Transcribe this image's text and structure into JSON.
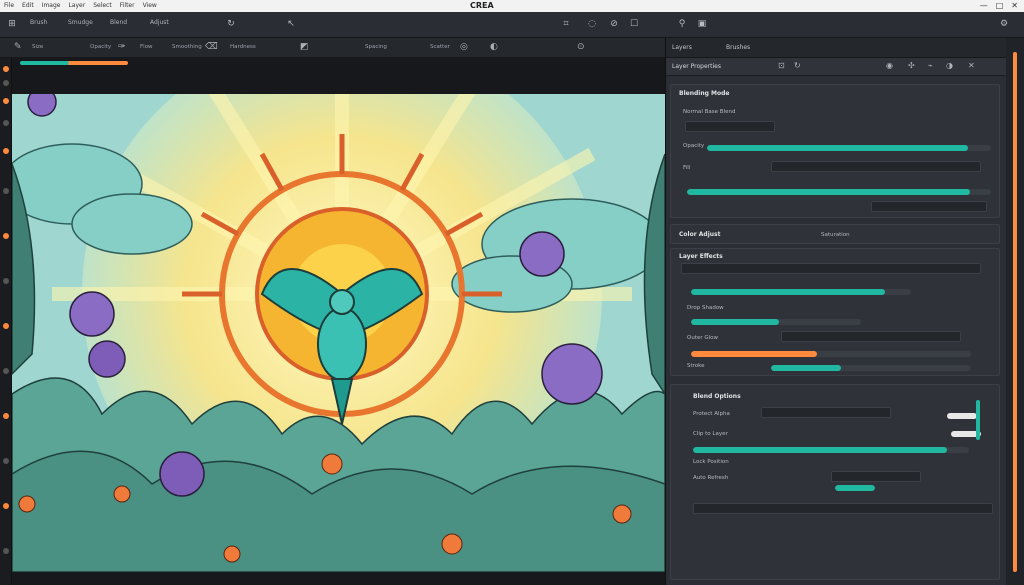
{
  "titlebar": {
    "menu": [
      "File",
      "Edit",
      "Image",
      "Layer",
      "Select",
      "Filter",
      "View"
    ],
    "title": "CREA",
    "window_buttons": [
      "—",
      "□",
      "✕"
    ]
  },
  "toolbar1": {
    "items": [
      "Brush",
      "Smudge",
      "Blend",
      "Adjust"
    ],
    "icons": [
      "rotate-icon",
      "cursor-icon",
      "crop-icon",
      "lasso-icon",
      "eyedropper-icon",
      "hand-icon",
      "zoom-icon"
    ]
  },
  "toolbar2": {
    "items": [
      "Size",
      "Opacity",
      "Flow",
      "Smoothing",
      "Hardness",
      "Spacing",
      "Scatter"
    ],
    "icons": [
      "brush-icon",
      "pen-icon",
      "eraser-icon",
      "fill-icon",
      "blur-icon",
      "gradient-icon"
    ]
  },
  "canvas": {
    "progress": 1.0,
    "accent_teal": "#20b8a0",
    "accent_orange": "#ff8a3d"
  },
  "panel": {
    "tabs": [
      "Layers",
      "Brushes"
    ],
    "header_label": "Layer Properties",
    "sections": {
      "general": {
        "title": "Blending Mode",
        "subtitle": "Normal Base Blend",
        "opacity_label": "Opacity",
        "opacity_value": 0.92,
        "fill_label": "Fill",
        "fill_value": 0.93
      },
      "color": {
        "title": "Color Adjust",
        "label": "Saturation",
        "value": 0.88
      },
      "effects": {
        "title": "Layer Effects",
        "row1_label": "Drop Shadow",
        "row1_value": 0.52,
        "row2_label": "Outer Glow",
        "row2_value": 0.45,
        "row3_label": "Stroke",
        "row3_value": 0.35
      },
      "options": {
        "title": "Blend Options",
        "opt1": "Protect Alpha",
        "opt2": "Clip to Layer",
        "opt3": "Lock Position",
        "opt4": "Auto Refresh",
        "value": 0.92
      }
    },
    "accent_teal": "#20b8a0",
    "accent_orange": "#ff8a3d"
  }
}
